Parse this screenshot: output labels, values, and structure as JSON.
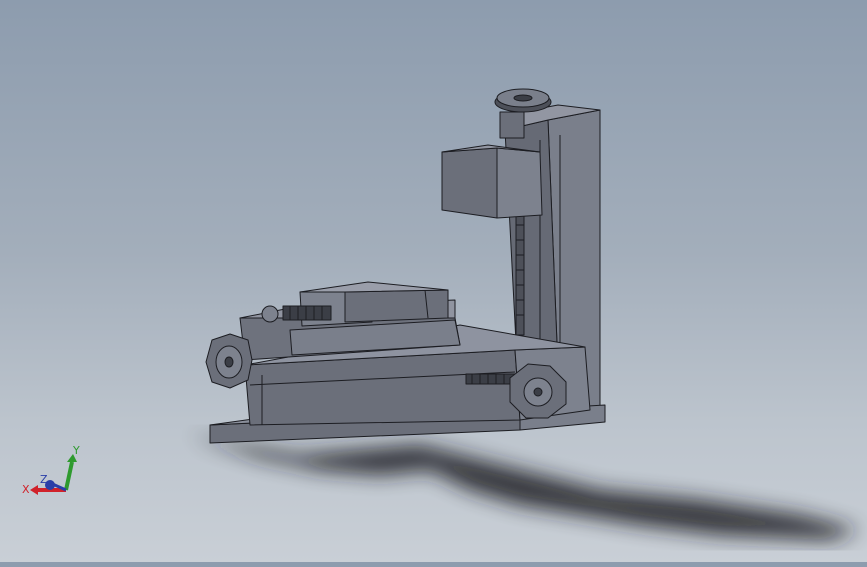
{
  "scene": {
    "model": "cnc-mill-assembly",
    "background_top": "#8d9cae",
    "background_bottom": "#c9cfd6",
    "part_color": "#6b6f7a",
    "part_light": "#858a96",
    "part_dark": "#4d5059",
    "edge_color": "#1c1d22"
  },
  "triad": {
    "x_label": "X",
    "y_label": "Y",
    "z_label": "Z",
    "x_color": "#d0222a",
    "y_color": "#2e9a2e",
    "z_color": "#2a3ea8"
  }
}
